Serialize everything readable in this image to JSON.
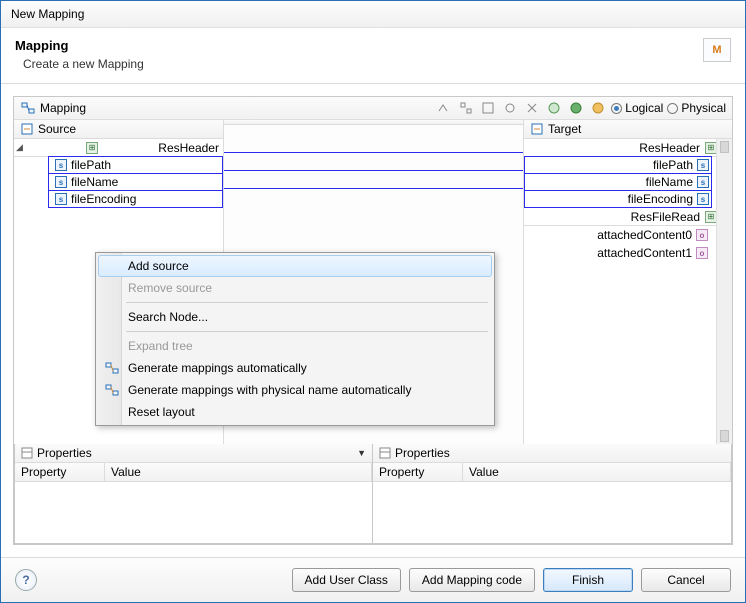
{
  "window": {
    "title": "New Mapping"
  },
  "header": {
    "title": "Mapping",
    "subtitle": "Create a new Mapping",
    "icon_letter": "M"
  },
  "toolbar": {
    "section_label": "Mapping",
    "radio_logical": "Logical",
    "radio_physical": "Physical"
  },
  "source": {
    "title": "Source",
    "root": "ResHeader",
    "fields": [
      "filePath",
      "fileName",
      "fileEncoding"
    ]
  },
  "target": {
    "title": "Target",
    "groups": [
      {
        "name": "ResHeader",
        "fields": [
          "filePath",
          "fileName",
          "fileEncoding"
        ],
        "field_type": "s"
      },
      {
        "name": "ResFileRead",
        "fields": [
          "attachedContent0",
          "attachedContent1"
        ],
        "field_type": "o"
      }
    ]
  },
  "context_menu": {
    "items": [
      {
        "label": "Add source",
        "enabled": true,
        "hover": true
      },
      {
        "label": "Remove source",
        "enabled": false
      },
      {
        "sep": true
      },
      {
        "label": "Search Node...",
        "enabled": true
      },
      {
        "sep": true
      },
      {
        "label": "Expand tree",
        "enabled": false
      },
      {
        "label": "Generate mappings automatically",
        "enabled": true,
        "icon": "gen"
      },
      {
        "label": "Generate mappings with physical name automatically",
        "enabled": true,
        "icon": "gen"
      },
      {
        "label": "Reset layout",
        "enabled": true
      }
    ]
  },
  "props": {
    "title": "Properties",
    "col_property": "Property",
    "col_value": "Value"
  },
  "footer": {
    "add_user_class": "Add User Class",
    "add_mapping_code": "Add Mapping code",
    "finish": "Finish",
    "cancel": "Cancel"
  }
}
